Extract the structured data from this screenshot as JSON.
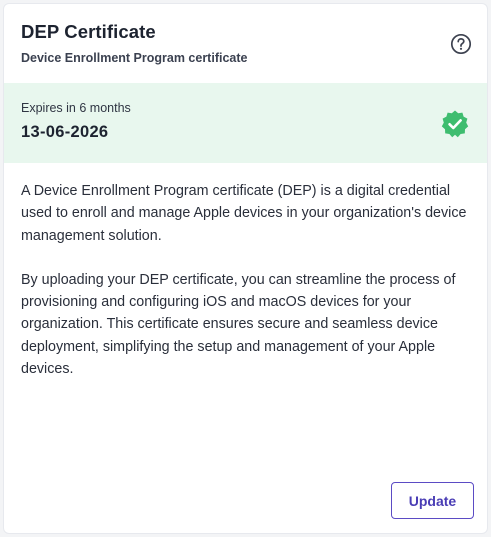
{
  "certificate": {
    "title": "DEP Certificate",
    "subtitle": "Device Enrollment Program certificate",
    "help_icon": "help-circle-icon"
  },
  "expiry": {
    "label": "Expires in 6 months",
    "date": "13-06-2026",
    "status_icon": "verified-badge-icon",
    "status_color": "#3ebd6f",
    "panel_color": "#e8f7ee"
  },
  "description": {
    "paragraph_1": "A Device Enrollment Program certificate (DEP) is a digital credential used to enroll and manage Apple devices in your organization's device management solution.",
    "paragraph_2": "By uploading your DEP certificate, you can streamline the process of provisioning and configuring iOS and macOS devices for your organization. This certificate ensures secure and seamless device deployment, simplifying the setup and management of your Apple devices."
  },
  "actions": {
    "update_label": "Update",
    "accent_color": "#5b4bc4"
  }
}
